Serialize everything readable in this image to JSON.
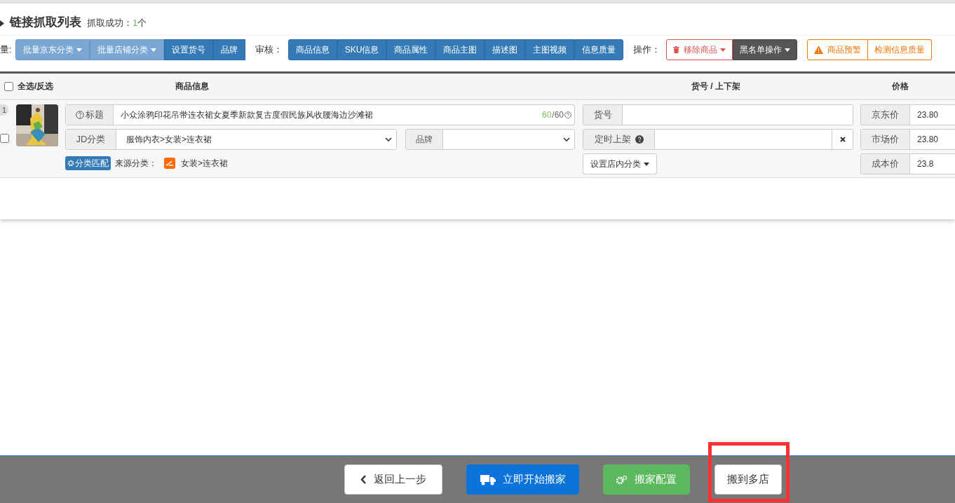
{
  "header": {
    "title": "链接抓取列表",
    "status_label": "抓取成功：",
    "status_count": "1",
    "status_unit": "个"
  },
  "toolbar": {
    "batch_label": "量:",
    "batch_buttons": [
      {
        "label": "批量京东分类",
        "kind": "light",
        "dropdown": true
      },
      {
        "label": "批量店铺分类",
        "kind": "light",
        "dropdown": true
      },
      {
        "label": "设置货号",
        "kind": "blue",
        "dropdown": false
      },
      {
        "label": "品牌",
        "kind": "blue",
        "dropdown": false
      }
    ],
    "review_label": "审核：",
    "review_buttons": [
      "商品信息",
      "SKU信息",
      "商品属性",
      "商品主图",
      "描述图",
      "主图视频",
      "信息质量"
    ],
    "ops_label": "操作：",
    "ops_buttons": [
      {
        "label": "移除商品",
        "kind": "danger"
      },
      {
        "label": "黑名单操作",
        "kind": "dark"
      }
    ],
    "warn_buttons": [
      {
        "label": "商品预警",
        "kind": "warning"
      },
      {
        "label": "检测信息质量",
        "kind": "warning-plain"
      }
    ]
  },
  "table": {
    "select_all": {
      "label": "全选/反选",
      "checked": false
    },
    "columns": [
      "商品信息",
      "货号 / 上下架",
      "价格"
    ],
    "rows": [
      {
        "index": "1",
        "checked": false,
        "title_label": "标题",
        "title_value": "小众涂鸦印花吊带连衣裙女夏季新款复古度假民族风收腰海边沙滩裙",
        "count_used": "60",
        "count_total": "/60",
        "category_label": "JD分类",
        "category_value": "服饰内衣>女装>连衣裙",
        "brand_label": "品牌",
        "match_button": "分类匹配",
        "source_label": "来源分类：",
        "source_value": "女装>连衣裙",
        "sku_label": "货号",
        "schedule_label": "定时上架",
        "shop_category_button": "设置店内分类",
        "prices": [
          {
            "label": "京东价",
            "value": "23.80"
          },
          {
            "label": "市场价",
            "value": "23.80"
          },
          {
            "label": "成本价",
            "value": "23.8"
          }
        ]
      }
    ]
  },
  "footer": {
    "buttons": [
      {
        "label": "返回上一步",
        "kind": "back",
        "highlighted": false
      },
      {
        "label": "立即开始搬家",
        "kind": "primary",
        "highlighted": false
      },
      {
        "label": "搬家配置",
        "kind": "success",
        "highlighted": false
      },
      {
        "label": "搬到多店",
        "kind": "default",
        "highlighted": true
      }
    ]
  }
}
